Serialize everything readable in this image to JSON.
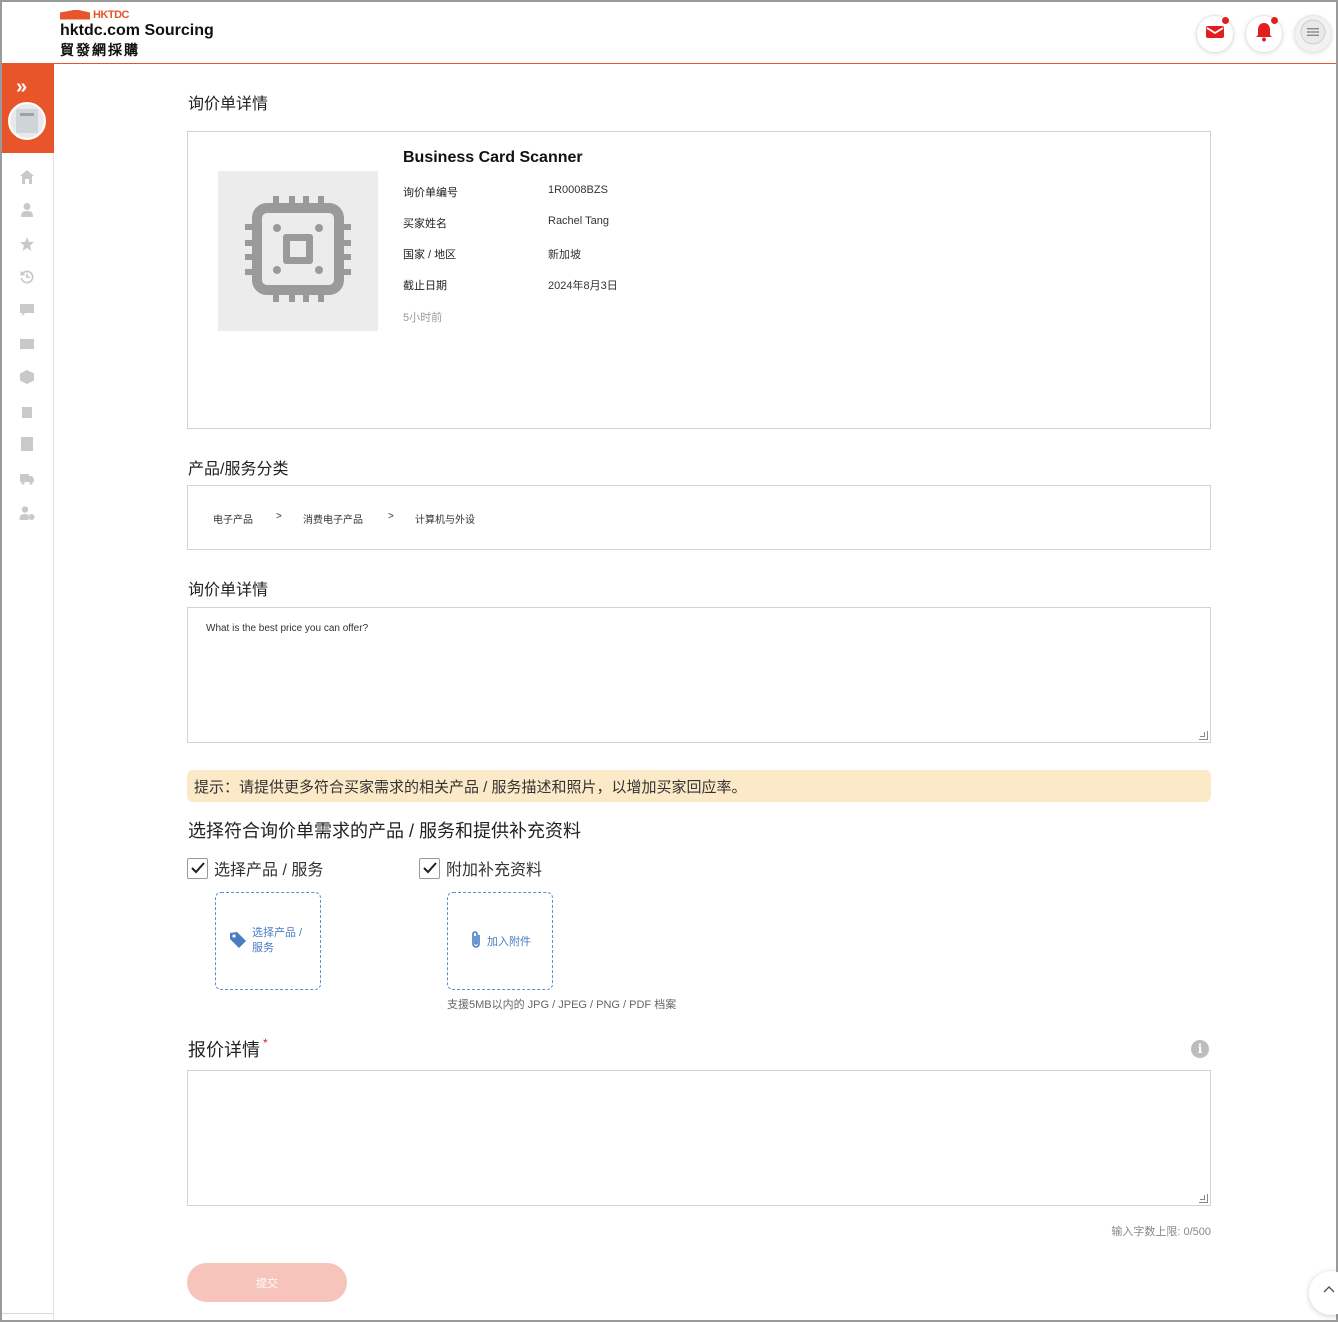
{
  "header": {
    "logo_mark": "HKTDC",
    "brand_title": "hktdc.com Sourcing",
    "brand_subtitle": "貿發網採購",
    "mail_icon": "mail-icon",
    "bell_icon": "bell-icon",
    "menu_icon": "hamburger-icon",
    "accent_color": "#e8552b",
    "notification_dot_color": "#e31e1e"
  },
  "sidebar": {
    "expand_icon": "double-chevron-right-icon",
    "items": [
      {
        "icon": "home-icon"
      },
      {
        "icon": "user-icon"
      },
      {
        "icon": "star-icon"
      },
      {
        "icon": "history-icon"
      },
      {
        "icon": "message-icon"
      },
      {
        "icon": "browser-window-icon"
      },
      {
        "icon": "box-icon"
      },
      {
        "icon": "bag-icon"
      },
      {
        "icon": "list-document-icon"
      },
      {
        "icon": "truck-icon"
      },
      {
        "icon": "user-settings-icon"
      }
    ]
  },
  "enquiry_card": {
    "section_title": "询价单详情",
    "product_name": "Business Card Scanner",
    "image_icon": "chip-placeholder-icon",
    "fields": [
      {
        "label": "询价单编号",
        "value": "1R0008BZS"
      },
      {
        "label": "买家姓名",
        "value": "Rachel Tang"
      },
      {
        "label": "国家 / 地区",
        "value": "新加坡"
      },
      {
        "label": "截止日期",
        "value": "2024年8月3日"
      }
    ],
    "time_ago": "5小时前"
  },
  "category": {
    "section_title": "产品/服务分类",
    "path": [
      "电子产品",
      "消费电子产品",
      "计算机与外设"
    ],
    "separator": ">"
  },
  "enquiry_details": {
    "section_title": "询价单详情",
    "text": "What is the best price you can offer?"
  },
  "tip": {
    "text": "提示：请提供更多符合买家需求的相关产品 / 服务描述和照片，以增加买家回应率。",
    "bg_color": "#fbe9c8"
  },
  "select_section": {
    "title": "选择符合询价单需求的产品 / 服务和提供补充资料",
    "checkbox_products": {
      "label": "选择产品 / 服务",
      "checked": true
    },
    "checkbox_attachments": {
      "label": "附加补充资料",
      "checked": true
    },
    "select_products_button": "选择产品 / 服务",
    "add_attachment_button": "加入附件",
    "attachment_hint": "支援5MB以内的 JPG / JPEG / PNG / PDF 档案"
  },
  "quote": {
    "title": "报价详情",
    "required_mark": "*",
    "info_icon": "info-icon",
    "value": "",
    "counter": "输入字数上限: 0/500"
  },
  "submit_button": "提交",
  "scroll_top_icon": "chevron-up-icon"
}
